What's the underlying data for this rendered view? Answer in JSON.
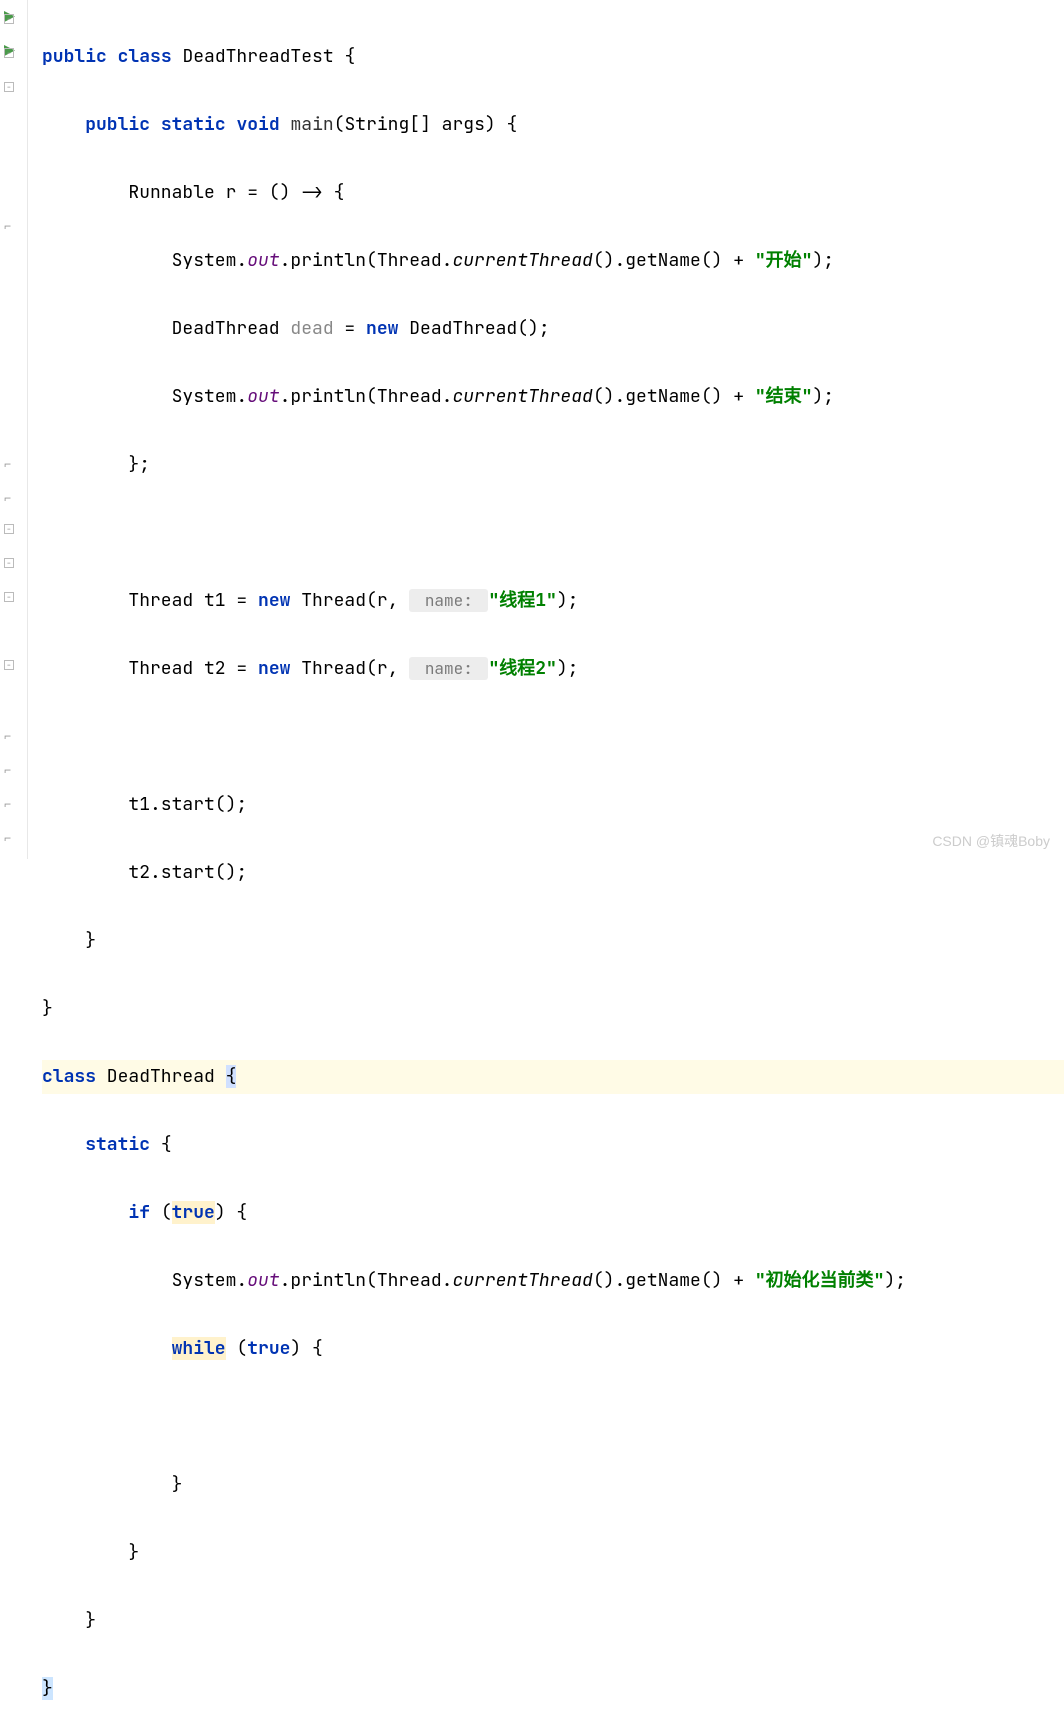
{
  "code": {
    "line1_public": "public",
    "line1_class": "class",
    "line1_name": "DeadThreadTest",
    "line1_brace": " {",
    "line2_public": "public",
    "line2_static": "static",
    "line2_void": "void",
    "line2_main": "main",
    "line2_params": "(String[] args) {",
    "line3": "Runnable r = () -> {",
    "line4_sys": "System.",
    "line4_out": "out",
    "line4_print": ".println(Thread.",
    "line4_curthread": "currentThread",
    "line4_getname": "().getName() + ",
    "line4_str": "\"开始\"",
    "line4_end": ");",
    "line5_pre": "DeadThread ",
    "line5_dead": "dead",
    "line5_eq": " = ",
    "line5_new": "new",
    "line5_ctor": " DeadThread();",
    "line6_sys": "System.",
    "line6_out": "out",
    "line6_print": ".println(Thread.",
    "line6_curthread": "currentThread",
    "line6_getname": "().getName() + ",
    "line6_str": "\"结束\"",
    "line6_end": ");",
    "line7": "};",
    "line9_pre": "Thread t1 = ",
    "line9_new": "new",
    "line9_thread": " Thread(r, ",
    "line9_hint": " name: ",
    "line9_str": "\"线程1\"",
    "line9_end": ");",
    "line10_pre": "Thread t2 = ",
    "line10_new": "new",
    "line10_thread": " Thread(r, ",
    "line10_hint": " name: ",
    "line10_str": "\"线程2\"",
    "line10_end": ");",
    "line12": "t1.start();",
    "line13": "t2.start();",
    "line14": "}",
    "line15": "}",
    "line16_class": "class",
    "line16_name": " DeadThread ",
    "line16_brace": "{",
    "line17_static": "static",
    "line17_brace": " {",
    "line18_if": "if",
    "line18_open": " (",
    "line18_true": "true",
    "line18_close": ") {",
    "line19_sys": "System.",
    "line19_out": "out",
    "line19_print": ".println(Thread.",
    "line19_curthread": "currentThread",
    "line19_getname": "().getName() + ",
    "line19_str": "\"初始化当前类\"",
    "line19_end": ");",
    "line20_while": "while",
    "line20_open": " (",
    "line20_true": "true",
    "line20_close": ") {",
    "line22": "}",
    "line23": "}",
    "line24": "}",
    "line25": "}"
  },
  "watermark": "CSDN @镇魂Boby"
}
